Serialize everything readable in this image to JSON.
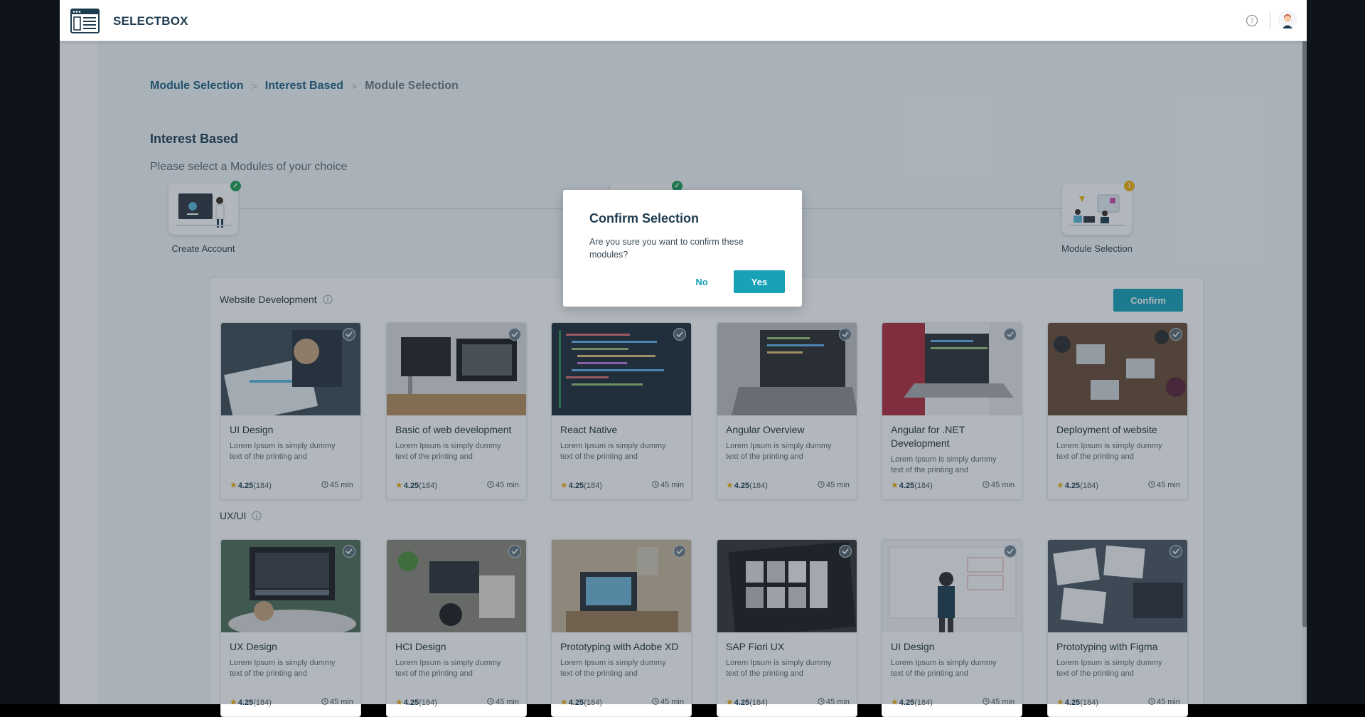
{
  "app": {
    "brand": "SELECTBOX",
    "icons": {
      "logo": "app-window-icon",
      "help": "help-circle-icon",
      "avatar": "user-avatar-icon"
    }
  },
  "breadcrumb": {
    "items": [
      "Module Selection",
      "Interest Based",
      "Module Selection"
    ],
    "separator": ">"
  },
  "page": {
    "title": "Interest Based",
    "subtitle": "Please select a Modules of your choice"
  },
  "stepper": {
    "steps": [
      {
        "label": "Create Account",
        "status": "done"
      },
      {
        "label": "",
        "status": "done"
      },
      {
        "label": "Module Selection",
        "status": "pending"
      }
    ],
    "colors": {
      "done": "#1e9e56",
      "pending": "#f2b20d"
    }
  },
  "sections": [
    {
      "title": "Website Development",
      "confirm_label": "Confirm",
      "cards": [
        {
          "title": "UI Design",
          "desc": "Lorem Ipsum is simply dummy text of the printing and",
          "rating": "4.25",
          "reviews": "(184)",
          "duration": "45 min",
          "image": "designer-sketching"
        },
        {
          "title": "Basic of web development",
          "desc": "Lorem Ipsum is simply dummy text of the printing and",
          "rating": "4.25",
          "reviews": "(184)",
          "duration": "45 min",
          "image": "imac-desk"
        },
        {
          "title": "React Native",
          "desc": "Lorem Ipsum is simply dummy text of the printing and",
          "rating": "4.25",
          "reviews": "(184)",
          "duration": "45 min",
          "image": "code-screen"
        },
        {
          "title": "Angular Overview",
          "desc": "Lorem Ipsum is simply dummy text of the printing and",
          "rating": "4.25",
          "reviews": "(184)",
          "duration": "45 min",
          "image": "laptop-code"
        },
        {
          "title": "Angular for .NET Development",
          "desc": "Lorem Ipsum is simply dummy text of the printing and",
          "rating": "4.25",
          "reviews": "(184)",
          "duration": "45 min",
          "image": "laptop-team"
        },
        {
          "title": "Deployment of website",
          "desc": "Lorem Ipsum is simply dummy text of the printing and",
          "rating": "4.25",
          "reviews": "(184)",
          "duration": "45 min",
          "image": "team-table"
        }
      ]
    },
    {
      "title": "UX/UI",
      "cards": [
        {
          "title": "UX Design",
          "desc": "Lorem Ipsum is simply dummy text of the printing and",
          "rating": "4.25",
          "reviews": "(184)",
          "duration": "45 min",
          "image": "laptop-editing"
        },
        {
          "title": "HCI Design",
          "desc": "Lorem Ipsum is simply dummy text of the printing and",
          "rating": "4.25",
          "reviews": "(184)",
          "duration": "45 min",
          "image": "desk-overhead"
        },
        {
          "title": "Prototyping with Adobe XD",
          "desc": "Lorem Ipsum is simply dummy text of the printing and",
          "rating": "4.25",
          "reviews": "(184)",
          "duration": "45 min",
          "image": "laptop-room"
        },
        {
          "title": "SAP Fiori UX",
          "desc": "Lorem Ipsum is simply dummy text of the printing and",
          "rating": "4.25",
          "reviews": "(184)",
          "duration": "45 min",
          "image": "monitor-gallery"
        },
        {
          "title": "UI Design",
          "desc": "Lorem Ipsum is simply dummy text of the printing and",
          "rating": "4.25",
          "reviews": "(184)",
          "duration": "45 min",
          "image": "whiteboard"
        },
        {
          "title": "Prototyping with Figma",
          "desc": "Lorem Ipsum is simply dummy text of the printing and",
          "rating": "4.25",
          "reviews": "(184)",
          "duration": "45 min",
          "image": "sketch-papers"
        }
      ]
    }
  ],
  "modal": {
    "title": "Confirm Selection",
    "body": "Are you sure you want to confirm these modules?",
    "no_label": "No",
    "yes_label": "Yes"
  },
  "colors": {
    "accent": "#17a2b8",
    "heading": "#1d3b4f",
    "link": "#1e5f80",
    "star": "#f2a90d"
  }
}
